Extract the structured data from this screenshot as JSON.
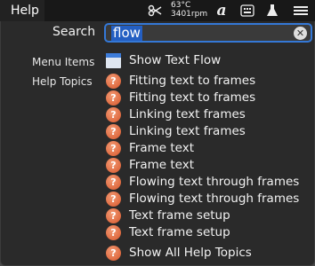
{
  "menubar": {
    "help_label": "Help",
    "temp_label": "63°C",
    "rpm_label": "3401rpm",
    "icons": [
      "scissors-icon",
      "text-a-icon",
      "keyboard-icon",
      "flask-icon",
      "list-icon"
    ]
  },
  "search": {
    "label": "Search",
    "value": "flow"
  },
  "sections": {
    "menu_items_label": "Menu Items",
    "help_topics_label": "Help Topics"
  },
  "menu_items": [
    {
      "label": "Show Text Flow"
    }
  ],
  "help_topics": [
    {
      "label": "Fitting text to frames"
    },
    {
      "label": "Fitting text to frames"
    },
    {
      "label": "Linking text frames"
    },
    {
      "label": "Linking text frames"
    },
    {
      "label": "Frame text"
    },
    {
      "label": "Frame text"
    },
    {
      "label": "Flowing text through frames"
    },
    {
      "label": "Flowing text through frames"
    },
    {
      "label": "Text frame setup"
    },
    {
      "label": "Text frame setup"
    }
  ],
  "footer": {
    "show_all_label": "Show All Help Topics"
  },
  "colors": {
    "accent": "#3478d6",
    "help_icon": "#e0663a"
  }
}
